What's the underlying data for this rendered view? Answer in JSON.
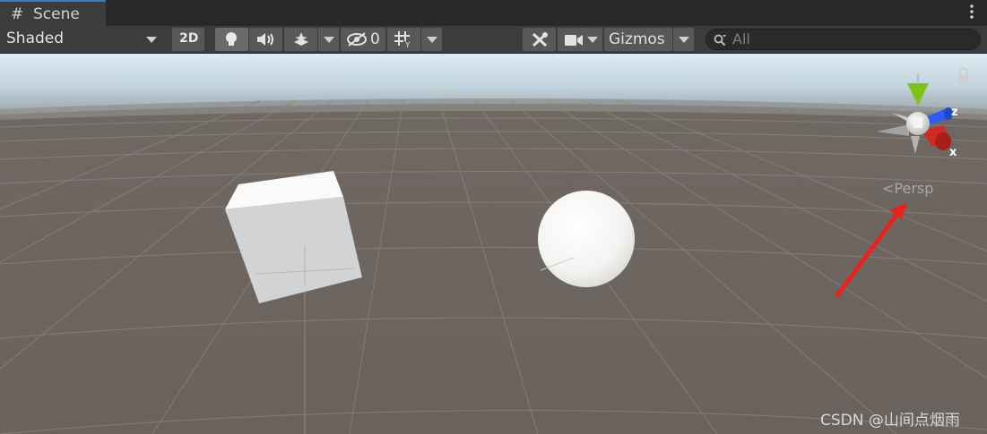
{
  "tab": {
    "title": "Scene",
    "icon": "hash-icon"
  },
  "toolbar": {
    "draw_mode": "Shaded",
    "mode_2d_label": "2D",
    "hidden_count": "0",
    "gizmos_label": "Gizmos",
    "search_placeholder": "All"
  },
  "viewport": {
    "projection_label": "Persp",
    "axis_labels": {
      "y": "",
      "z": "z",
      "x": "x"
    },
    "objects": [
      "cube",
      "sphere"
    ],
    "annotation_arrow_color": "#e8231f"
  },
  "watermark": "CSDN @山间点烟雨",
  "colors": {
    "toolbar_bg": "#3c3c3c",
    "tab_accent": "#3a79bb",
    "ground": "#6d6560",
    "sky": "#c6dbe8",
    "gizmo_y": "#7ec21a",
    "gizmo_z": "#2d5ef0",
    "gizmo_x": "#d02a22"
  }
}
